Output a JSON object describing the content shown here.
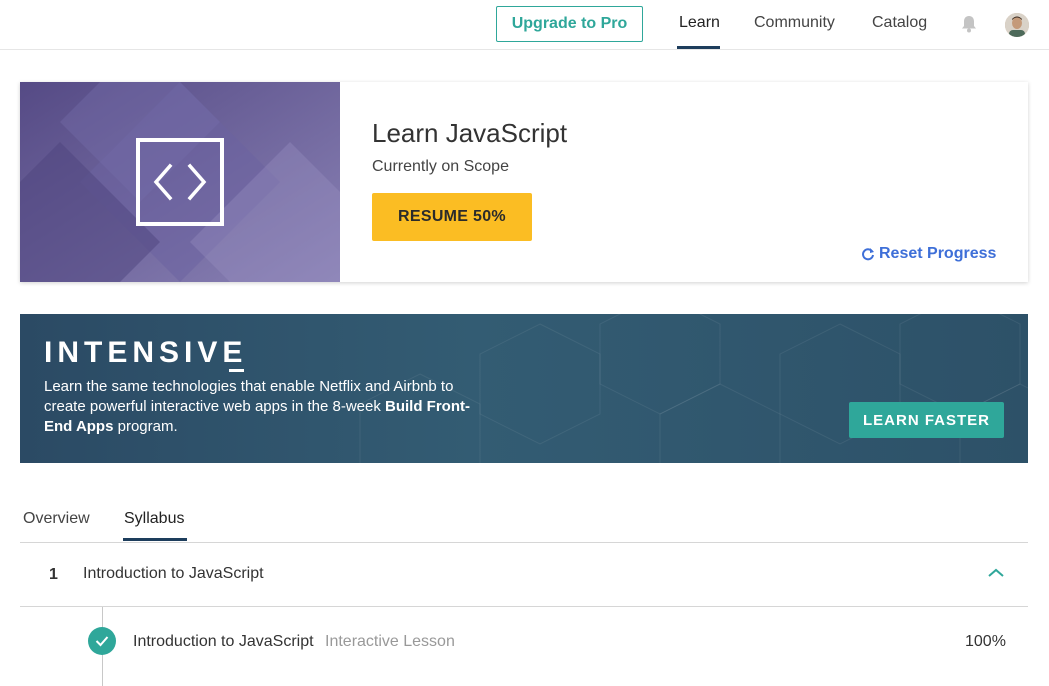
{
  "topnav": {
    "upgrade_label": "Upgrade to Pro",
    "links": [
      {
        "label": "Learn",
        "active": true
      },
      {
        "label": "Community",
        "active": false
      },
      {
        "label": "Catalog",
        "active": false
      }
    ],
    "bell_icon": "bell-icon",
    "avatar": "user-avatar"
  },
  "course": {
    "title": "Learn JavaScript",
    "subtitle": "Currently on Scope",
    "resume_label": "RESUME 50%",
    "progress_percent": 50,
    "reset_label": "Reset Progress",
    "hero_icon": "code-brackets-icon",
    "hero_color": "#5b5089"
  },
  "intensive": {
    "logo": "INTENSIVE",
    "text_part1": "Learn the same technologies that enable Netflix and Airbnb to create powerful interactive web apps in the 8-week ",
    "text_bold": "Build Front-End Apps",
    "text_part2": " program.",
    "cta_label": "LEARN FASTER"
  },
  "tabs": [
    {
      "label": "Overview",
      "active": false
    },
    {
      "label": "Syllabus",
      "active": true
    }
  ],
  "syllabus": {
    "modules": [
      {
        "number": "1",
        "title": "Introduction to JavaScript",
        "expanded": true,
        "lessons": [
          {
            "title": "Introduction to JavaScript",
            "type": "Interactive Lesson",
            "progress": "100%",
            "completed": true
          }
        ]
      }
    ]
  },
  "colors": {
    "accent_teal": "#2fa79a",
    "resume_yellow": "#fbbd23",
    "link_blue": "#3e6fd8",
    "nav_underline": "#1d3d5c"
  }
}
